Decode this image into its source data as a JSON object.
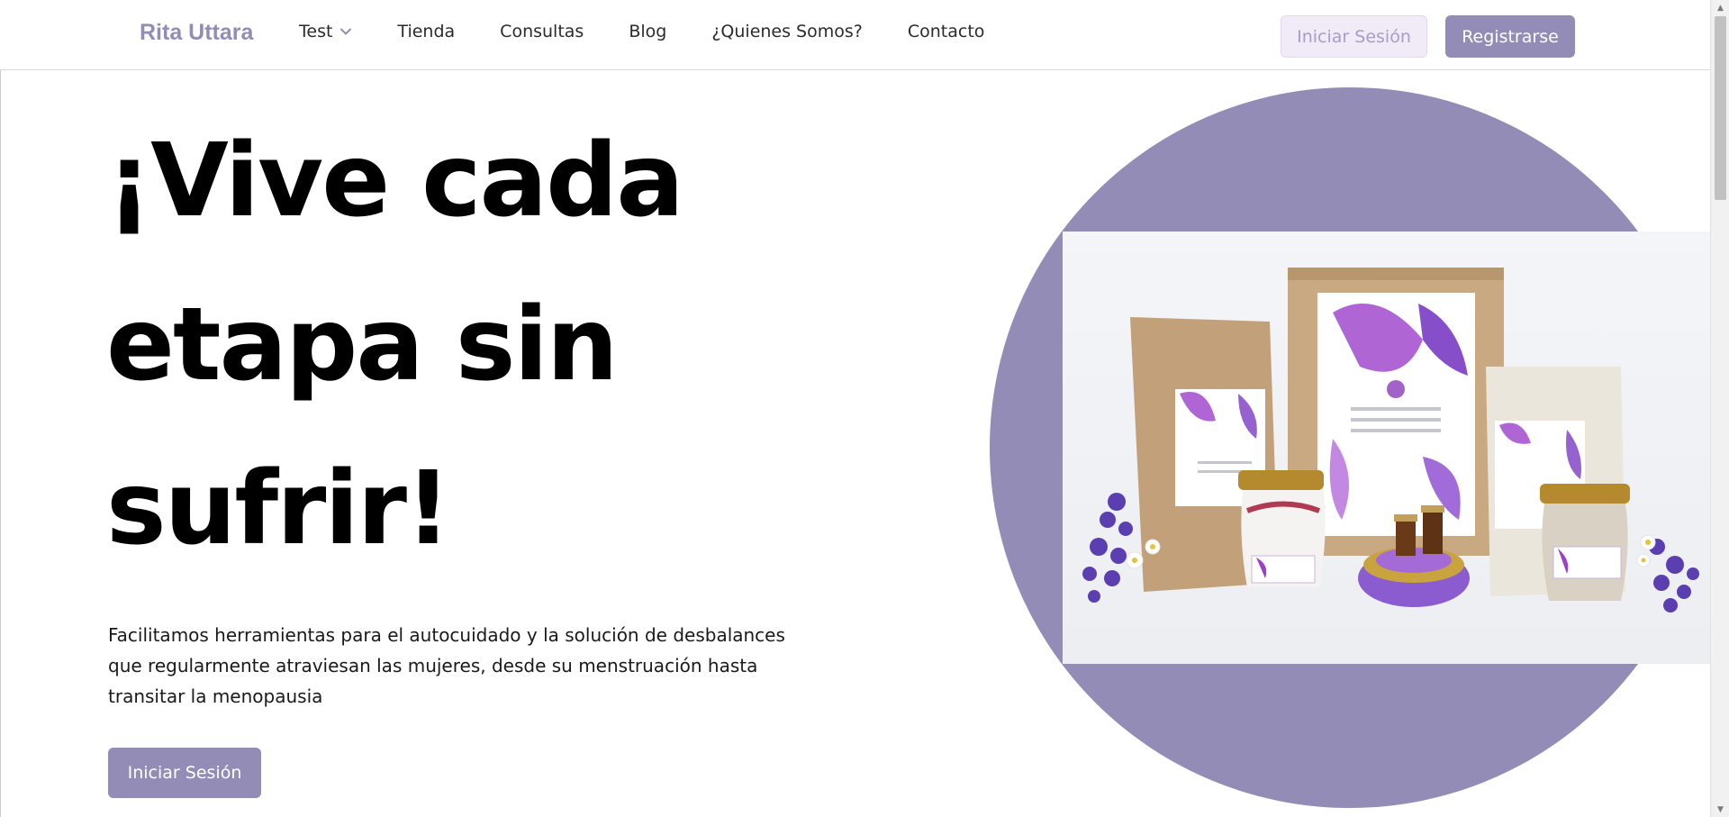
{
  "navbar": {
    "brand": "Rita Uttara",
    "links": [
      {
        "label": "Test",
        "has_dropdown": true
      },
      {
        "label": "Tienda"
      },
      {
        "label": "Consultas"
      },
      {
        "label": "Blog"
      },
      {
        "label": "¿Quienes Somos?"
      },
      {
        "label": "Contacto"
      }
    ],
    "login_label": "Iniciar Sesión",
    "register_label": "Registrarse"
  },
  "hero": {
    "title": "¡Vive cada etapa sin sufrir!",
    "description": "Facilitamos herramientas para el autocuidado y la solución de desbalances que regularmente atraviesan las mujeres, desde su menstruación hasta transitar la menopausia",
    "cta_label": "Iniciar Sesión"
  },
  "colors": {
    "accent": "#938cb6",
    "login_bg": "#f0ebf7",
    "login_text": "#a79dc7"
  },
  "icons": {
    "dropdown": "chevron-down-icon",
    "scroll_up": "scroll-up-arrow-icon",
    "scroll_down": "scroll-down-arrow-icon"
  }
}
